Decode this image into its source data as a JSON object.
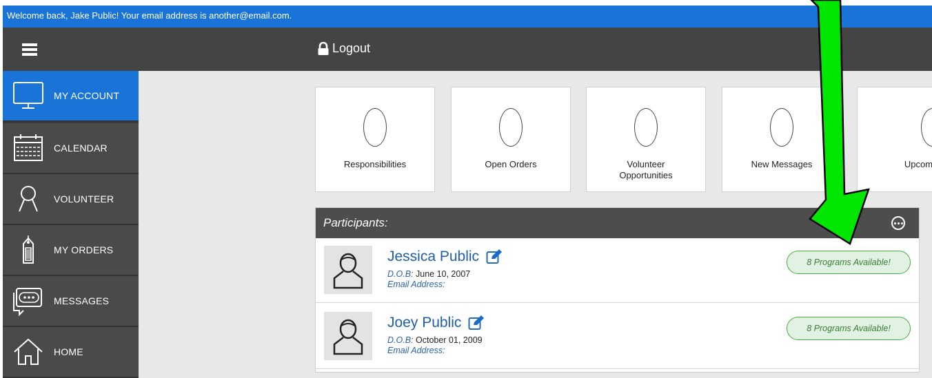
{
  "welcome": {
    "text": "Welcome back, Jake Public! Your email address is another@email.com."
  },
  "topbar": {
    "menu_icon": "hamburger-icon",
    "logout_label": "Logout",
    "logout_icon": "lock-icon"
  },
  "sidebar": {
    "items": [
      {
        "label": "MY ACCOUNT",
        "icon": "monitor-icon",
        "active": true
      },
      {
        "label": "CALENDAR",
        "icon": "calendar-icon",
        "active": false
      },
      {
        "label": "VOLUNTEER",
        "icon": "person-icon",
        "active": false
      },
      {
        "label": "MY ORDERS",
        "icon": "tag-icon",
        "active": false
      },
      {
        "label": "MESSAGES",
        "icon": "chat-icon",
        "active": false
      },
      {
        "label": "HOME",
        "icon": "home-icon",
        "active": false
      }
    ]
  },
  "stats": [
    {
      "label": "Responsibilities"
    },
    {
      "label": "Open Orders"
    },
    {
      "label": "Volunteer Opportunities"
    },
    {
      "label": "New Messages"
    },
    {
      "label": "Upcomi"
    }
  ],
  "participants": {
    "title": "Participants:",
    "more_icon": "ellipsis-circle-icon",
    "list": [
      {
        "name": "Jessica Public",
        "dob_label": "D.O.B:",
        "dob": "June 10, 2007",
        "email_label": "Email Address:",
        "programs": "8 Programs Available!"
      },
      {
        "name": "Joey Public",
        "dob_label": "D.O.B:",
        "dob": "October 01, 2009",
        "email_label": "Email Address:",
        "programs": "8 Programs Available!"
      }
    ]
  },
  "annotation": {
    "arrow_color": "#00e600",
    "icon": "green-arrow-icon"
  },
  "colors": {
    "accent": "#1a73d6",
    "topbar": "#444444",
    "sidebar": "#4a4a4a",
    "badge_green": "#4aa54a"
  }
}
